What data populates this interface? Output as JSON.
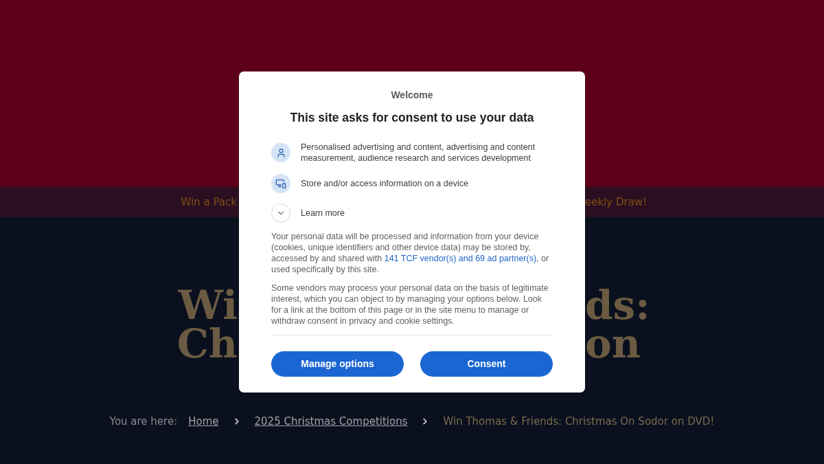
{
  "page": {
    "promo_strip": {
      "left_fragment": "Win a Pack",
      "right_fragment": "eekly Draw!"
    },
    "headline": {
      "rows": [
        {
          "left": "Wi",
          "right": "ds:"
        },
        {
          "left": "Ch",
          "right": "on"
        }
      ]
    },
    "breadcrumb": {
      "label": "You are here:",
      "items": [
        {
          "text": "Home",
          "kind": "link"
        },
        {
          "text": "2025 Christmas Competitions",
          "kind": "link"
        },
        {
          "text": "Win Thomas & Friends: Christmas On Sodor on DVD!",
          "kind": "current"
        }
      ]
    }
  },
  "consent_dialog": {
    "welcome": "Welcome",
    "title": "This site asks for consent to use your data",
    "purposes": [
      {
        "kind": "person",
        "text": "Personalised advertising and content, advertising and content measurement, audience research and services development"
      },
      {
        "kind": "device",
        "text": "Store and/or access information on a device"
      }
    ],
    "learn_more": {
      "label": "Learn more",
      "expanded": false
    },
    "notice": {
      "before": "Your personal data will be processed and information from your device (cookies, unique identifiers and other device data) may be stored by, accessed by and shared with ",
      "link": "141 TCF vendor(s) and 69 ad partner(s)",
      "after": ", or used specifically by this site."
    },
    "legitimate_interest": "Some vendors may process your personal data on the basis of legitimate interest, which you can object to by managing your options below. Look for a link at the bottom of this page or in the site menu to manage or withdraw consent in privacy and cookie settings.",
    "buttons": [
      "Manage options",
      "Consent"
    ]
  }
}
